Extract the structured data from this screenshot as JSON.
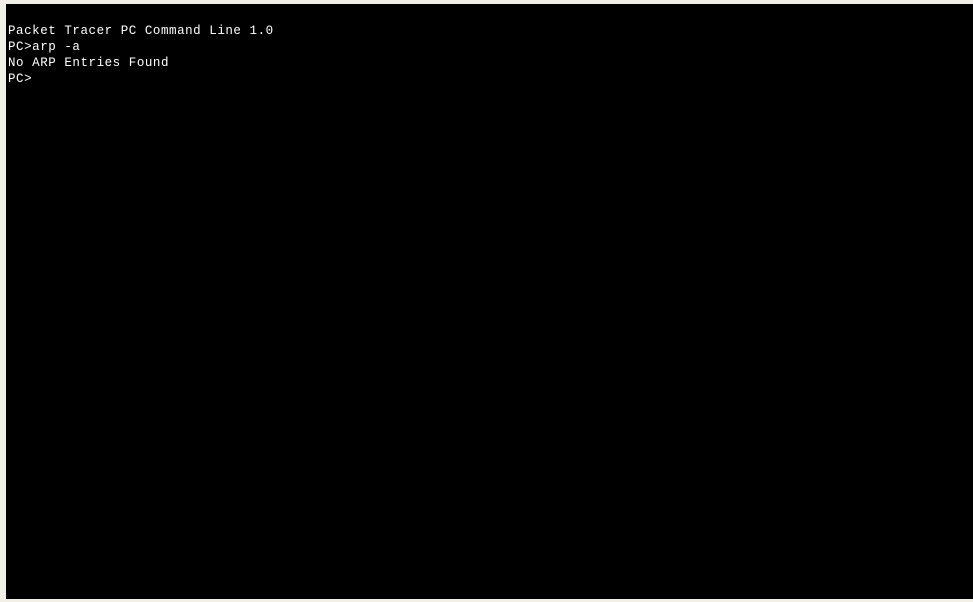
{
  "app": {
    "name": "Packet Tracer PC Command Line",
    "version": "1.0",
    "window_title": "Packet Tracer PC Command Line 1.0"
  },
  "theme": {
    "page_background": "#f2efe6",
    "terminal_background": "#000000",
    "terminal_foreground": "#ffffff",
    "prompt_color": "#ffffff"
  },
  "terminal": {
    "prompt": "PC>",
    "cursor_visible": false,
    "lines": [
      {
        "id": "banner",
        "text": "Packet Tracer PC Command Line 1.0",
        "kind": "banner"
      },
      {
        "id": "command-1",
        "text": "PC>arp -a",
        "kind": "command"
      },
      {
        "id": "output-1",
        "text": "No ARP Entries Found",
        "kind": "output"
      },
      {
        "id": "prompt-active",
        "text": "PC>",
        "kind": "prompt"
      }
    ],
    "commands_entered": [
      {
        "prompt": "PC>",
        "command": "arp -a",
        "response": "No ARP Entries Found"
      }
    ]
  }
}
